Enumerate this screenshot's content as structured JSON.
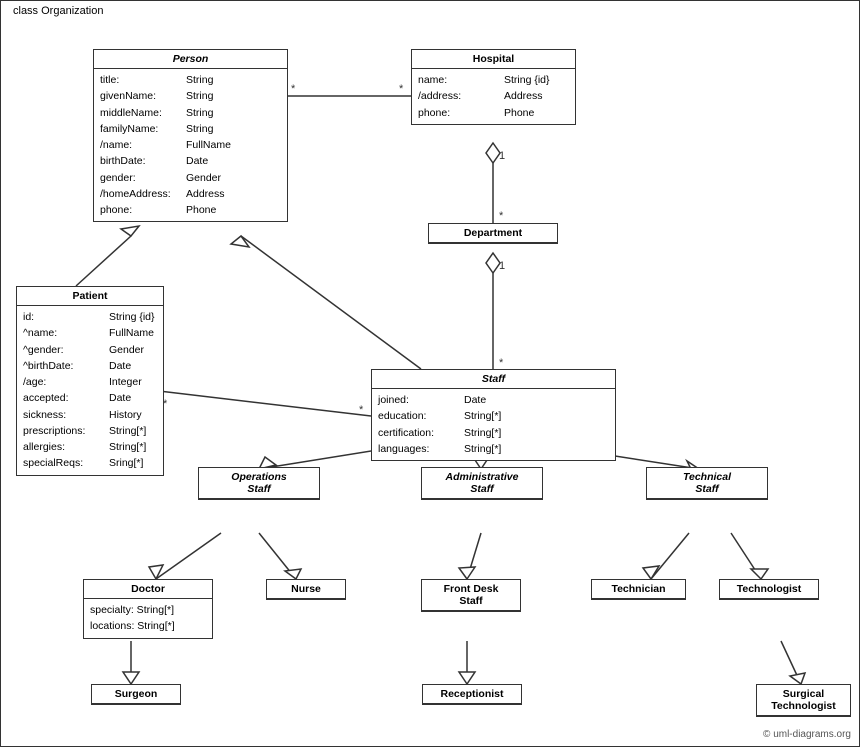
{
  "diagram": {
    "title": "class Organization",
    "classes": {
      "person": {
        "name": "Person",
        "italic": true,
        "attrs": [
          [
            "title:",
            "String"
          ],
          [
            "givenName:",
            "String"
          ],
          [
            "middleName:",
            "String"
          ],
          [
            "familyName:",
            "String"
          ],
          [
            "/name:",
            "FullName"
          ],
          [
            "birthDate:",
            "Date"
          ],
          [
            "gender:",
            "Gender"
          ],
          [
            "/homeAddress:",
            "Address"
          ],
          [
            "phone:",
            "Phone"
          ]
        ]
      },
      "hospital": {
        "name": "Hospital",
        "italic": false,
        "attrs": [
          [
            "name:",
            "String {id}"
          ],
          [
            "/address:",
            "Address"
          ],
          [
            "phone:",
            "Phone"
          ]
        ]
      },
      "department": {
        "name": "Department",
        "italic": false,
        "attrs": []
      },
      "staff": {
        "name": "Staff",
        "italic": true,
        "attrs": [
          [
            "joined:",
            "Date"
          ],
          [
            "education:",
            "String[*]"
          ],
          [
            "certification:",
            "String[*]"
          ],
          [
            "languages:",
            "String[*]"
          ]
        ]
      },
      "patient": {
        "name": "Patient",
        "italic": false,
        "attrs": [
          [
            "id:",
            "String {id}"
          ],
          [
            "^name:",
            "FullName"
          ],
          [
            "^gender:",
            "Gender"
          ],
          [
            "^birthDate:",
            "Date"
          ],
          [
            "/age:",
            "Integer"
          ],
          [
            "accepted:",
            "Date"
          ],
          [
            "sickness:",
            "History"
          ],
          [
            "prescriptions:",
            "String[*]"
          ],
          [
            "allergies:",
            "String[*]"
          ],
          [
            "specialReqs:",
            "Sring[*]"
          ]
        ]
      },
      "operations_staff": {
        "name": "Operations Staff",
        "italic": true
      },
      "administrative_staff": {
        "name": "Administrative Staff",
        "italic": true
      },
      "technical_staff": {
        "name": "Technical Staff",
        "italic": true
      },
      "doctor": {
        "name": "Doctor",
        "italic": false,
        "attrs": [
          [
            "specialty: String[*]"
          ],
          [
            "locations: String[*]"
          ]
        ]
      },
      "nurse": {
        "name": "Nurse",
        "italic": false,
        "attrs": []
      },
      "front_desk_staff": {
        "name": "Front Desk Staff",
        "italic": false,
        "attrs": []
      },
      "technician": {
        "name": "Technician",
        "italic": false,
        "attrs": []
      },
      "technologist": {
        "name": "Technologist",
        "italic": false,
        "attrs": []
      },
      "surgeon": {
        "name": "Surgeon",
        "italic": false,
        "attrs": []
      },
      "receptionist": {
        "name": "Receptionist",
        "italic": false,
        "attrs": []
      },
      "surgical_technologist": {
        "name": "Surgical Technologist",
        "italic": false,
        "attrs": []
      }
    },
    "copyright": "© uml-diagrams.org"
  }
}
